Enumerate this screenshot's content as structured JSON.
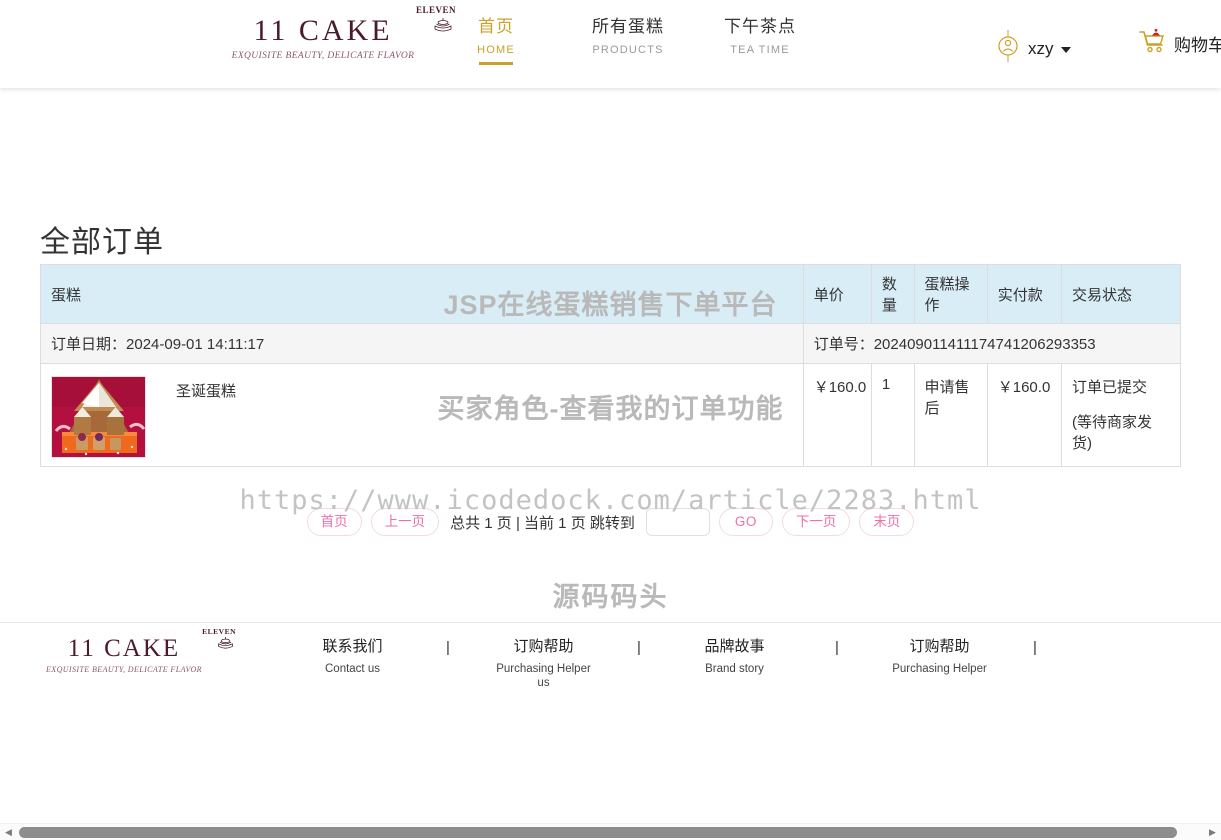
{
  "header": {
    "brand": {
      "main": "11 CAKE",
      "eleven": "ELEVEN",
      "tagline": "EXQUISITE BEAUTY, DELICATE FLAVOR"
    },
    "nav": [
      {
        "cn": "首页",
        "en": "HOME",
        "active": true
      },
      {
        "cn": "所有蛋糕",
        "en": "PRODUCTS",
        "active": false
      },
      {
        "cn": "下午茶点",
        "en": "TEA TIME",
        "active": false
      }
    ],
    "user": {
      "name": "xzy"
    },
    "cart": {
      "label": "购物车"
    }
  },
  "main": {
    "title": "全部订单",
    "table": {
      "columns": [
        "蛋糕",
        "单价",
        "数量",
        "蛋糕操作",
        "实付款",
        "交易状态"
      ],
      "orders": [
        {
          "date_label": "订单日期：",
          "date_value": "2024-09-01 14:11:17",
          "order_no_label": "订单号：",
          "order_no_value": "202409011411174741206293353",
          "items": [
            {
              "cake_name": "圣诞蛋糕",
              "unit_price": "￥160.0",
              "quantity": "1",
              "operation": "申请售后",
              "paid": "￥160.0",
              "status_line1": "订单已提交",
              "status_line2": "(等待商家发货)"
            }
          ]
        }
      ]
    },
    "pager": {
      "first": "首页",
      "prev": "上一页",
      "info": "总共 1 页 | 当前 1 页 跳转到",
      "input_value": "",
      "go": "GO",
      "next": "下一页",
      "last": "末页"
    }
  },
  "watermarks": {
    "line1": "JSP在线蛋糕销售下单平台",
    "line2": "买家角色-查看我的订单功能",
    "line3": "https://www.icodedock.com/article/2283.html",
    "line4": "源码码头"
  },
  "footer": {
    "brand": {
      "main": "11 CAKE",
      "eleven": "ELEVEN",
      "tagline": "EXQUISITE BEAUTY, DELICATE FLAVOR"
    },
    "links": [
      {
        "cn": "联系我们",
        "en": "Contact us"
      },
      {
        "cn": "订购帮助",
        "en": "Purchasing Helper us"
      },
      {
        "cn": "品牌故事",
        "en": "Brand story"
      },
      {
        "cn": "订购帮助",
        "en": "Purchasing Helper"
      }
    ],
    "separator": "|"
  },
  "colors": {
    "brand_wine": "#4a1b2e",
    "gold": "#c9a227",
    "table_head_bg": "#d9edf7",
    "meta_row_bg": "#f5f5f5",
    "pager_pink": "#ef6fa8"
  }
}
